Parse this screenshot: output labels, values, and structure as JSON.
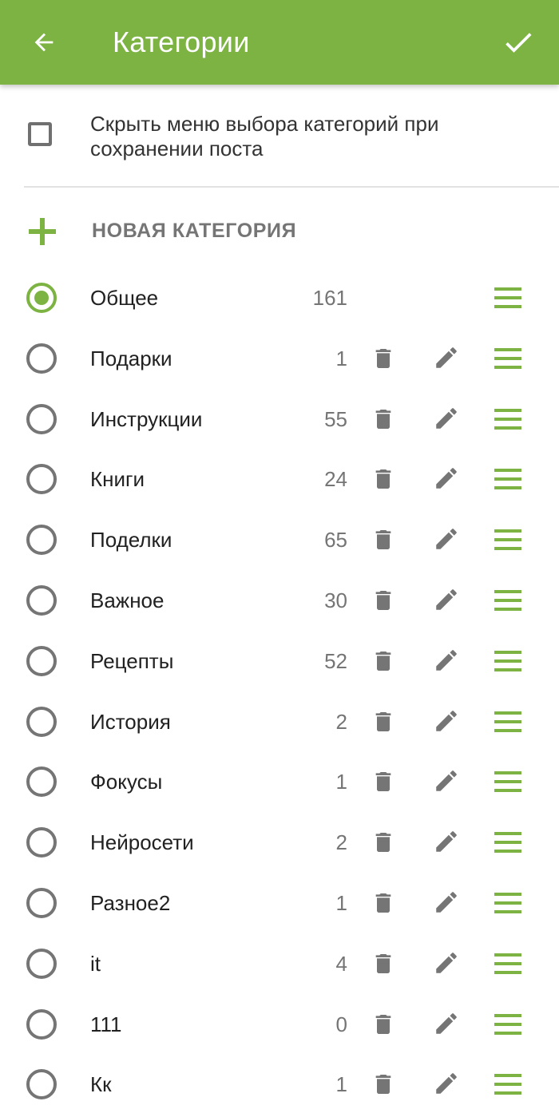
{
  "appbar": {
    "title": "Категории",
    "back_icon": "arrow-left-icon",
    "confirm_icon": "check-icon",
    "color": "#7cb342"
  },
  "option": {
    "hide_menu_label": "Скрыть меню выбора категорий при сохранении поста",
    "checked": false
  },
  "new_category": {
    "label": "НОВАЯ КАТЕГОРИЯ",
    "icon": "plus-icon"
  },
  "categories": [
    {
      "name": "Общее",
      "count": "161",
      "selected": true
    },
    {
      "name": "Подарки",
      "count": "1"
    },
    {
      "name": "Инструкции",
      "count": "55"
    },
    {
      "name": "Книги",
      "count": "24"
    },
    {
      "name": "Поделки",
      "count": "65"
    },
    {
      "name": "Важное",
      "count": "30"
    },
    {
      "name": "Рецепты",
      "count": "52"
    },
    {
      "name": "История",
      "count": "2"
    },
    {
      "name": "Фокусы",
      "count": "1"
    },
    {
      "name": "Нейросети",
      "count": "2"
    },
    {
      "name": "Разное2",
      "count": "1"
    },
    {
      "name": "it",
      "count": "4"
    },
    {
      "name": "111",
      "count": "0"
    },
    {
      "name": "Кк",
      "count": "1"
    }
  ],
  "colors": {
    "accent": "#7cb342",
    "icon_gray": "#757575",
    "text": "#212121"
  }
}
